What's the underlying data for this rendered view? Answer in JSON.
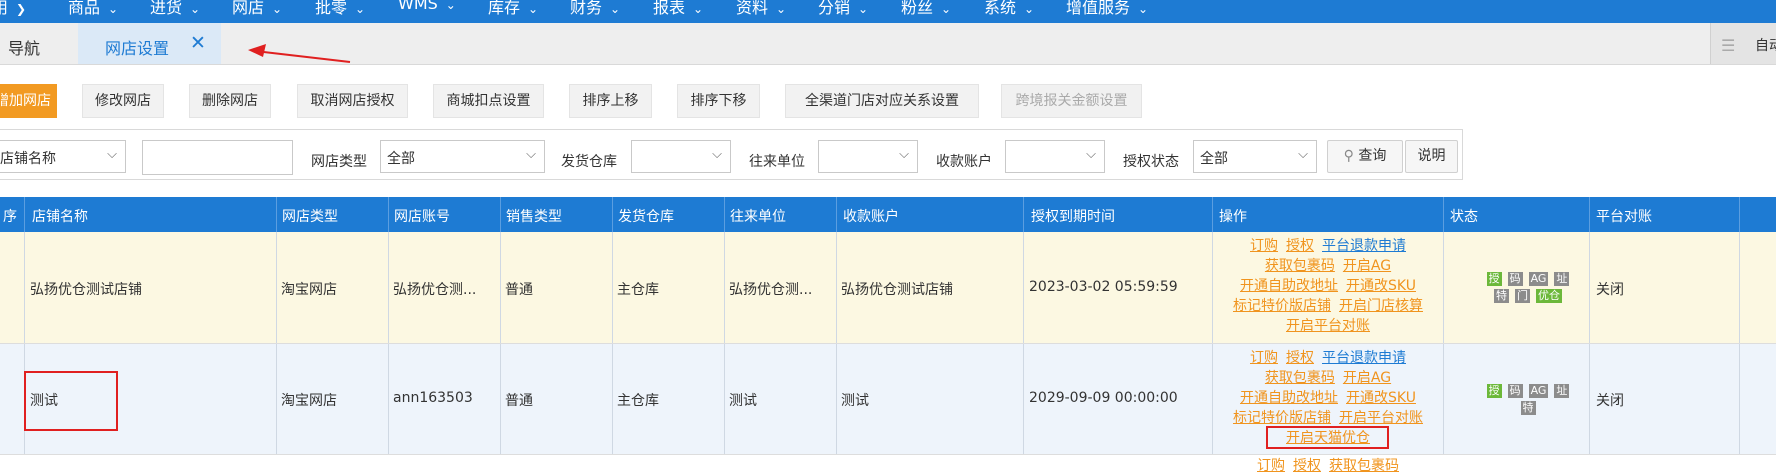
{
  "menu": [
    "用",
    "商品",
    "进货",
    "网店",
    "批零",
    "WMS",
    "库存",
    "财务",
    "报表",
    "资料",
    "分销",
    "粉丝",
    "系统",
    "增值服务"
  ],
  "tabs": {
    "nav_label": "导航",
    "active_label": "网店设置",
    "close_glyph": "✕",
    "right_text": "自动"
  },
  "toolbar": [
    "增加网店",
    "修改网店",
    "删除网店",
    "取消网店授权",
    "商城扣点设置",
    "排序上移",
    "排序下移",
    "全渠道门店对应关系设置",
    "跨境报关金额设置"
  ],
  "filters": {
    "field_select": "店铺名称",
    "shop_type_label": "网店类型",
    "shop_type_value": "全部",
    "warehouse_label": "发货仓库",
    "partner_label": "往来单位",
    "account_label": "收款账户",
    "auth_status_label": "授权状态",
    "auth_status_value": "全部",
    "query_button": "查询",
    "help_button": "说明"
  },
  "table": {
    "columns": [
      "序",
      "店铺名称",
      "网店类型",
      "网店账号",
      "销售类型",
      "发货仓库",
      "往来单位",
      "收款账户",
      "授权到期时间",
      "操作",
      "状态",
      "平台对账"
    ],
    "rows": [
      {
        "shop_name": "弘扬优仓测试店铺",
        "shop_type": "淘宝网店",
        "account": "弘扬优仓测...",
        "sale_type": "普通",
        "warehouse": "主仓库",
        "partner": "弘扬优仓测...",
        "payment_account": "弘扬优仓测试店铺",
        "auth_expiry": "2023-03-02 05:59:59",
        "actions": [
          [
            "订购",
            "授权",
            "平台退款申请"
          ],
          [
            "获取包裹码",
            "开启AG"
          ],
          [
            "开通自助改地址",
            "开通改SKU"
          ],
          [
            "标记特价版店铺",
            "开启门店核算"
          ],
          [
            "开启平台对账"
          ]
        ],
        "badges": [
          [
            "授",
            "码",
            "AG",
            "址"
          ],
          [
            "特",
            "门",
            "优仓"
          ]
        ],
        "reconcile": "关闭"
      },
      {
        "shop_name": "测试",
        "shop_type": "淘宝网店",
        "account": "ann163503",
        "sale_type": "普通",
        "warehouse": "主仓库",
        "partner": "测试",
        "payment_account": "测试",
        "auth_expiry": "2029-09-09 00:00:00",
        "actions": [
          [
            "订购",
            "授权",
            "平台退款申请"
          ],
          [
            "获取包裹码",
            "开启AG"
          ],
          [
            "开通自助改地址",
            "开通改SKU"
          ],
          [
            "标记特价版店铺",
            "开启平台对账"
          ],
          [
            "开启天猫优仓"
          ]
        ],
        "badges": [
          [
            "授",
            "码",
            "AG",
            "址"
          ],
          [
            "特"
          ]
        ],
        "reconcile": "关闭"
      }
    ],
    "partial_row_actions": [
      "订购",
      "授权",
      "获取包裹码"
    ]
  },
  "colors": {
    "primary": "#1e7bd3",
    "accent_orange": "#f29a22",
    "annotation_red": "#e02020",
    "row_highlight": "#fcf8e2",
    "row_alt": "#eef4fb"
  }
}
